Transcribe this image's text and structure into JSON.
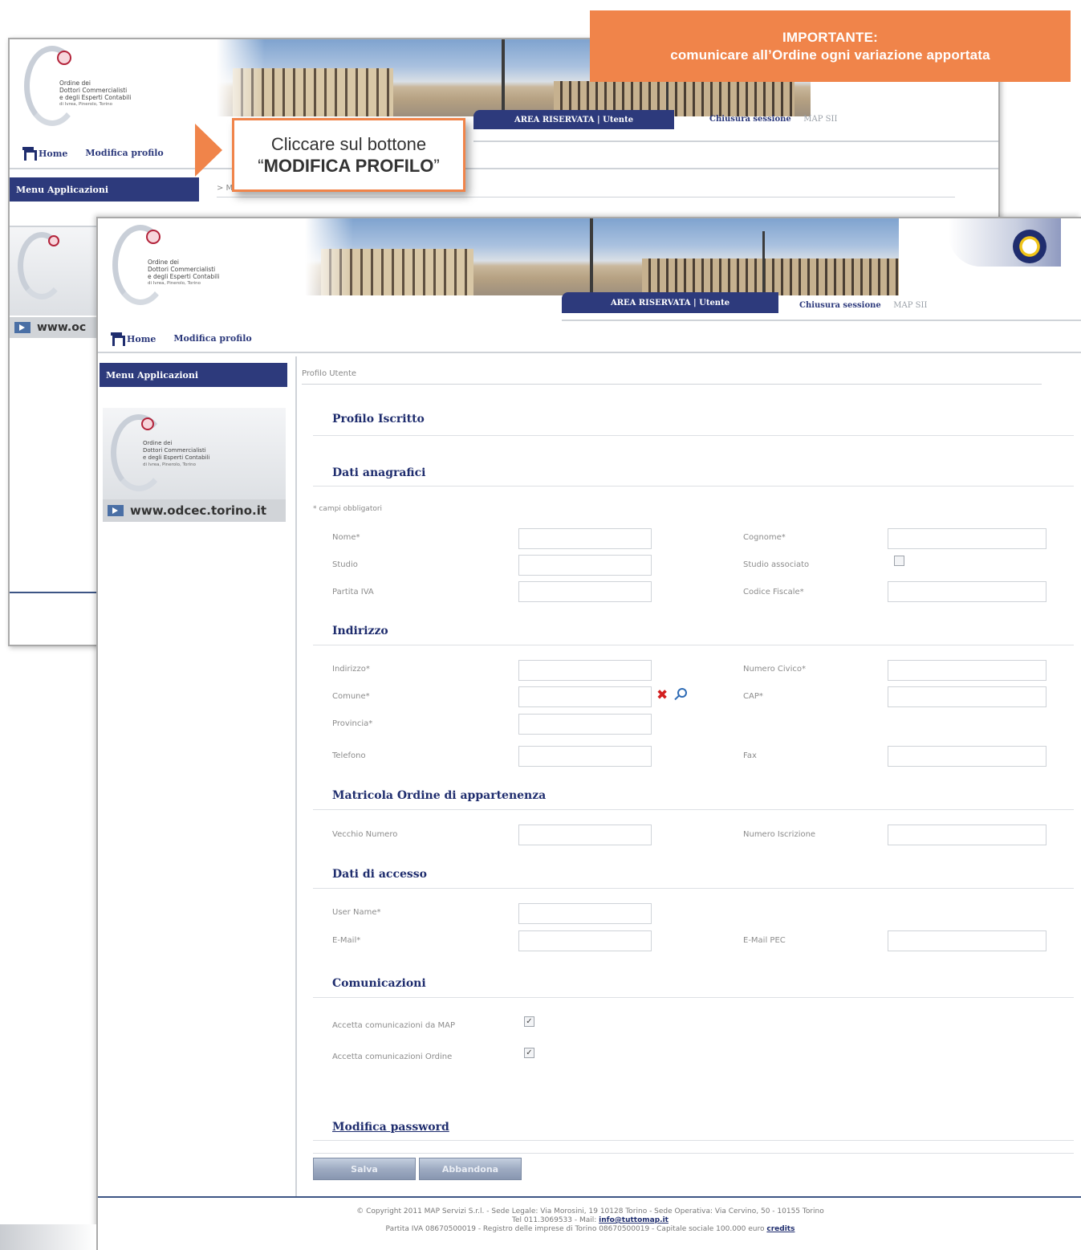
{
  "callouts": {
    "important_title": "IMPORTANTE:",
    "important_text": "comunicare all’Ordine ogni variazione apportata",
    "click_line1": "Cliccare sul bottone",
    "click_quote_open": "“",
    "click_button_name": "MODIFICA PROFILO",
    "click_quote_close": "”"
  },
  "logo": {
    "line1": "Ordine dei",
    "line2": "Dottori Commercialisti",
    "line3": "e degli Esperti Contabili",
    "line4": "di Ivrea, Pinerolo, Torino"
  },
  "back_window": {
    "area_tab": "AREA RISERVATA | Utente",
    "session": "Chiusura sessione",
    "user": "MAP SII",
    "nav_home": "Home",
    "nav_profile": "Modifica profilo",
    "menu_header": "Menu Applicazioni",
    "crumb": "> M",
    "url": "www.oc"
  },
  "header": {
    "area_tab": "AREA RISERVATA | Utente",
    "session": "Chiusura sessione",
    "user": "MAP SII",
    "nav_home": "Home",
    "nav_profile": "Modifica profilo"
  },
  "sidebar": {
    "menu_header": "Menu Applicazioni",
    "url": "www.odcec.torino.it"
  },
  "main": {
    "breadcrumb": "Profilo Utente",
    "page_title": "Profilo Iscritto",
    "required_note": "* campi obbligatori",
    "sections": {
      "anagrafici": "Dati anagrafici",
      "indirizzo": "Indirizzo",
      "matricola": "Matricola Ordine di appartenenza",
      "accesso": "Dati di accesso",
      "comunicazioni": "Comunicazioni"
    },
    "fields": {
      "nome": "Nome*",
      "cognome": "Cognome*",
      "studio": "Studio",
      "studio_associato": "Studio associato",
      "partita_iva": "Partita IVA",
      "codice_fiscale": "Codice Fiscale*",
      "indirizzo": "Indirizzo*",
      "numero_civico": "Numero Civico*",
      "comune": "Comune*",
      "cap": "CAP*",
      "provincia": "Provincia*",
      "telefono": "Telefono",
      "fax": "Fax",
      "vecchio_numero": "Vecchio Numero",
      "numero_iscrizione": "Numero Iscrizione",
      "user_name": "User Name*",
      "email": "E-Mail*",
      "email_pec": "E-Mail PEC",
      "com_map": "Accetta comunicazioni da MAP",
      "com_ordine": "Accetta comunicazioni Ordine"
    },
    "checks": {
      "studio_associato": "",
      "com_map": "✓",
      "com_ordine": "✓"
    },
    "password_link": "Modifica password",
    "save_button": "Salva",
    "cancel_button": "Abbandona"
  },
  "footer": {
    "line1": "© Copyright 2011 MAP Servizi S.r.l. - Sede Legale: Via Morosini, 19 10128 Torino - Sede Operativa: Via Cervino, 50 - 10155 Torino",
    "line2_prefix": "Tel 011.3069533 - Mail:",
    "line2_mail": "info@tuttomap.it",
    "line3_prefix": "Partita IVA 08670500019 - Registro delle imprese di Torino 08670500019 - Capitale sociale 100.000 euro",
    "line3_link": "credits"
  },
  "colors": {
    "accent_orange": "#f0844a",
    "navy": "#2d3a7c",
    "title_blue": "#1f2d6e"
  }
}
